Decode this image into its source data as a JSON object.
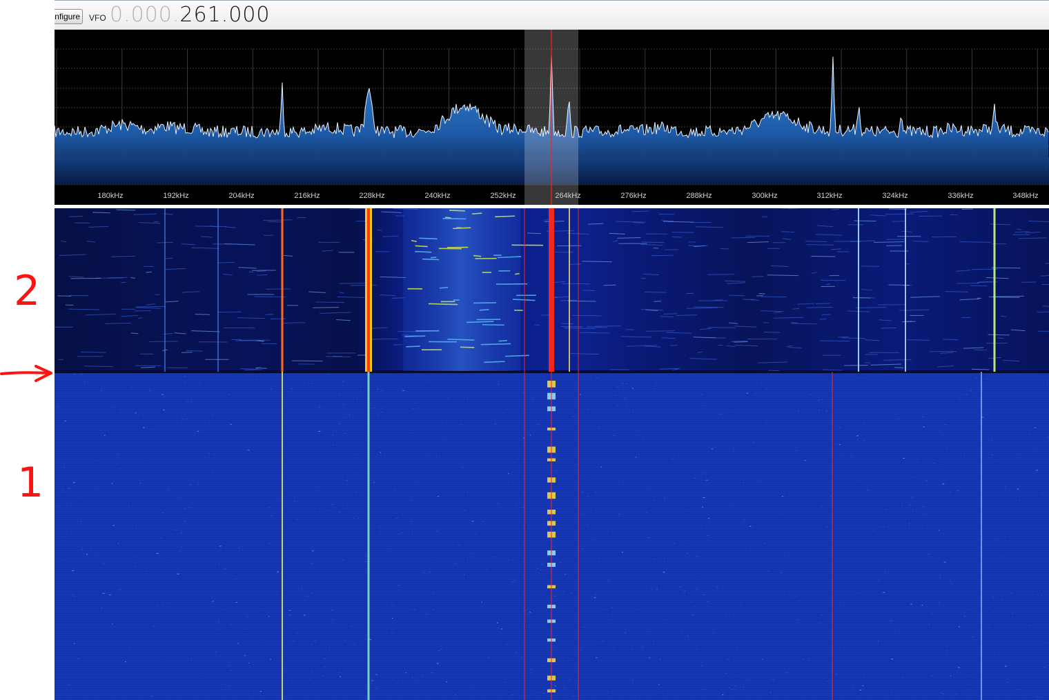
{
  "toolbar": {
    "configure_label": "Configure",
    "vfo_label": "VFO",
    "vfo_dim": "0.000.",
    "vfo_bright": "261.000"
  },
  "spectrum": {
    "freq_labels": [
      "180kHz",
      "192kHz",
      "204kHz",
      "216kHz",
      "228kHz",
      "240kHz",
      "252kHz",
      "264kHz",
      "276kHz",
      "288kHz",
      "300kHz",
      "312kHz",
      "324kHz",
      "336kHz",
      "348kHz"
    ]
  },
  "annotations": {
    "label_2": "2",
    "label_1": "1",
    "arrow": "arrow-right-icon"
  },
  "colors": {
    "marker_red": "#ff2020",
    "spectrum_fill": "#2d7fd0",
    "waterfall_blue": "#1434b0",
    "annotation_red": "#ff1212"
  }
}
